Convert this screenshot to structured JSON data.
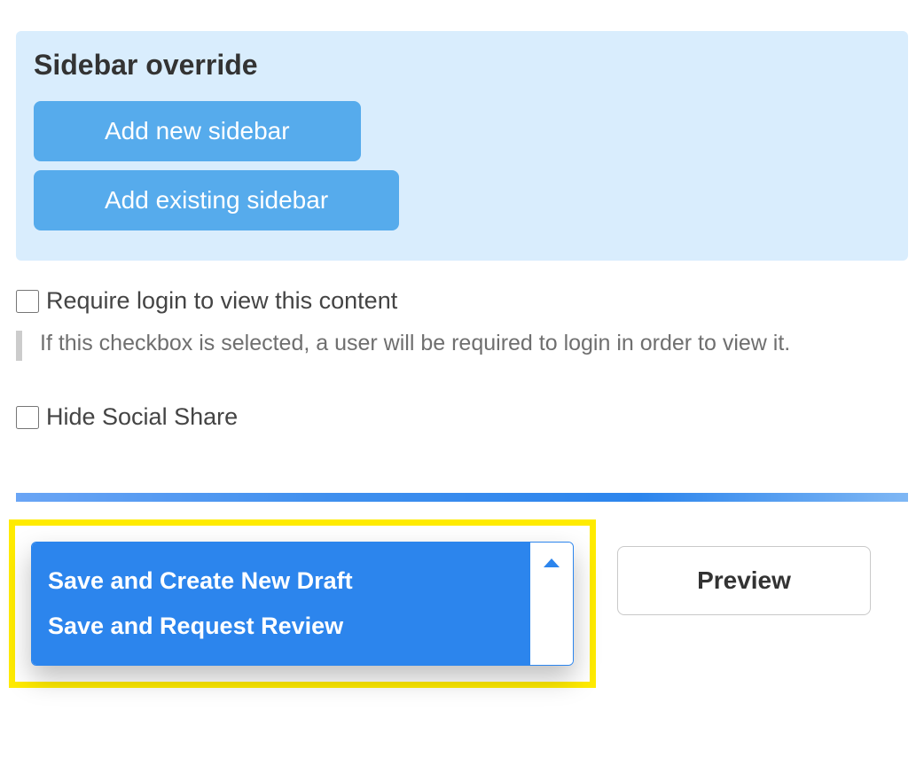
{
  "sidebar_override": {
    "title": "Sidebar override",
    "add_new_label": "Add new sidebar",
    "add_existing_label": "Add existing sidebar"
  },
  "options": {
    "require_login_label": "Require login to view this content",
    "require_login_help": "If this checkbox is selected, a user will be required to login in order to view it.",
    "hide_social_label": "Hide Social Share"
  },
  "actions": {
    "save_new_draft": "Save and Create New Draft",
    "save_request_review": "Save and Request Review",
    "preview": "Preview"
  }
}
